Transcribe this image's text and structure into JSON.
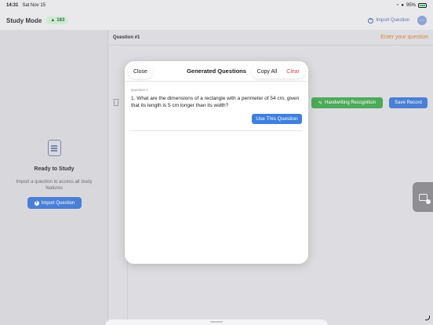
{
  "status_bar": {
    "time": "14:31",
    "date": "Sat Nov 15",
    "battery": "95%"
  },
  "header": {
    "title": "Study Mode",
    "points": "163",
    "import_label": "Import Question"
  },
  "left_panel": {
    "ready_title": "Ready to Study",
    "ready_subtitle": "Import a question to access all study features",
    "import_button": "Import Question"
  },
  "right_panel": {
    "question_label": "Question #1",
    "enter_question": "Enter your question",
    "handwriting_button": "Handwriting Recognition",
    "save_button": "Save Record"
  },
  "modal": {
    "close": "Close",
    "title": "Generated Questions",
    "copy_all": "Copy All",
    "clear": "Clear",
    "question_label": "Question 1",
    "question_text": "1. What are the dimensions of a rectangle with a perimeter of 54 cm, given that its length is 5 cm longer than its width?",
    "use_button": "Use This Question"
  },
  "colors": {
    "accent_blue": "#4a7fd6",
    "success_green": "#4caa59",
    "warning_orange": "#d9843a",
    "destructive_red": "#e5484d"
  },
  "icons": {
    "wifi": "wifi-icon",
    "person": "person-icon",
    "battery": "battery-icon",
    "flame": "flame-icon",
    "import": "plus-circle-icon",
    "menu": "ellipsis-icon",
    "document": "document-icon",
    "trash": "trash-icon",
    "handwriting": "pen-icon",
    "widget": "handwriting-widget-icon"
  }
}
